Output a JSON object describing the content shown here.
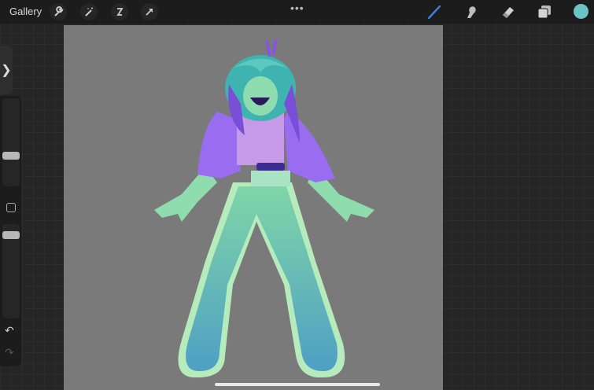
{
  "topbar": {
    "gallery_label": "Gallery",
    "left_tools": [
      "wrench-icon",
      "magic-wand-icon",
      "selection-icon",
      "transform-arrow-icon"
    ],
    "more_label": "•••",
    "right_tools": [
      "brush-icon",
      "smudge-icon",
      "eraser-icon",
      "layers-icon"
    ],
    "active_tool": "brush",
    "accent_color": "#3b7de0",
    "current_color": "#6cc3c5"
  },
  "sidebar": {
    "toggle_label": "❯",
    "brush_size": 0.33,
    "opacity": 0.92,
    "undo_label": "↶",
    "redo_label": "↷"
  }
}
